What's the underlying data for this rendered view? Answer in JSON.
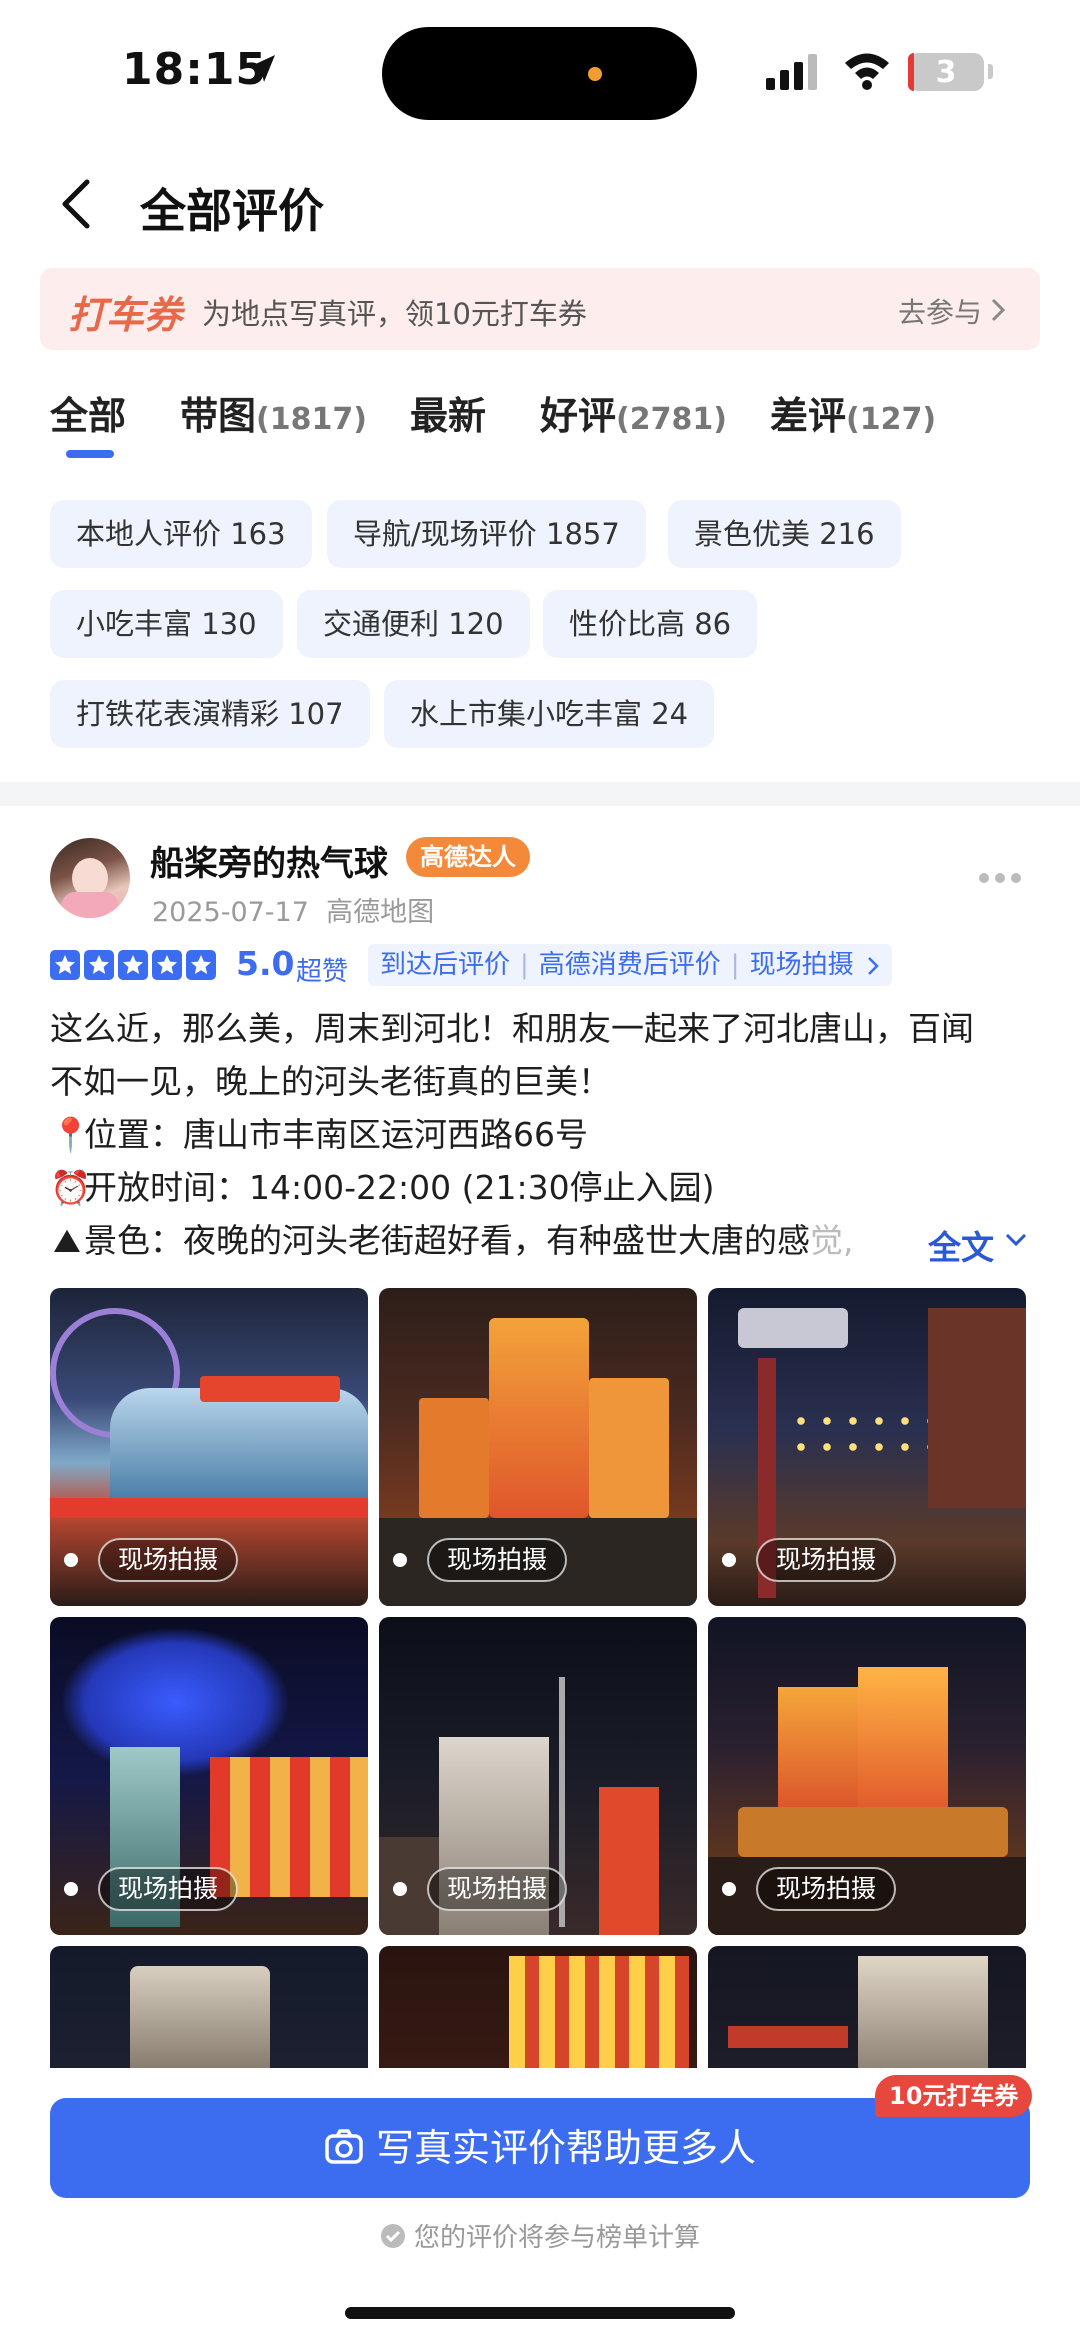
{
  "status_bar": {
    "time": "18:15",
    "battery": "3"
  },
  "header": {
    "title": "全部评价"
  },
  "promo": {
    "tag": "打车券",
    "text": "为地点写真评，领10元打车券",
    "link": "去参与"
  },
  "tabs": [
    {
      "label": "全部",
      "count": ""
    },
    {
      "label": "带图",
      "count": "(1817)"
    },
    {
      "label": "最新",
      "count": ""
    },
    {
      "label": "好评",
      "count": "(2781)"
    },
    {
      "label": "差评",
      "count": "(127)"
    }
  ],
  "chips": [
    "本地人评价 163",
    "导航/现场评价 1857",
    "景色优美 216",
    "小吃丰富 130",
    "交通便利 120",
    "性价比高 86",
    "打铁花表演精彩 107",
    "水上市集小吃丰富 24"
  ],
  "review": {
    "username": "船桨旁的热气球",
    "badge": "高德达人",
    "date": "2025-07-17",
    "source": "高德地图",
    "score": "5.0",
    "score_label": "超赞",
    "tags": [
      "到达后评价",
      "高德消费后评价",
      "现场拍摄"
    ],
    "lines": [
      "这么近，那么美，周末到河北！和朋友一起来了河北唐山，百闻",
      "不如一见，晚上的河头老街真的巨美！",
      "位置：唐山市丰南区运河西路66号",
      "开放时间：14:00-22:00 (21:30停止入园)",
      "景色：夜晚的河头老街超好看，有种盛世大唐的感",
      "觉,"
    ],
    "emojis": [
      "📍",
      "⏰",
      "⛰"
    ],
    "full_text_link": "全文",
    "photo_label": "现场拍摄"
  },
  "bottom": {
    "cta_label": "写真实评价帮助更多人",
    "cta_badge": "10元打车券",
    "footnote": "您的评价将参与榜单计算"
  }
}
